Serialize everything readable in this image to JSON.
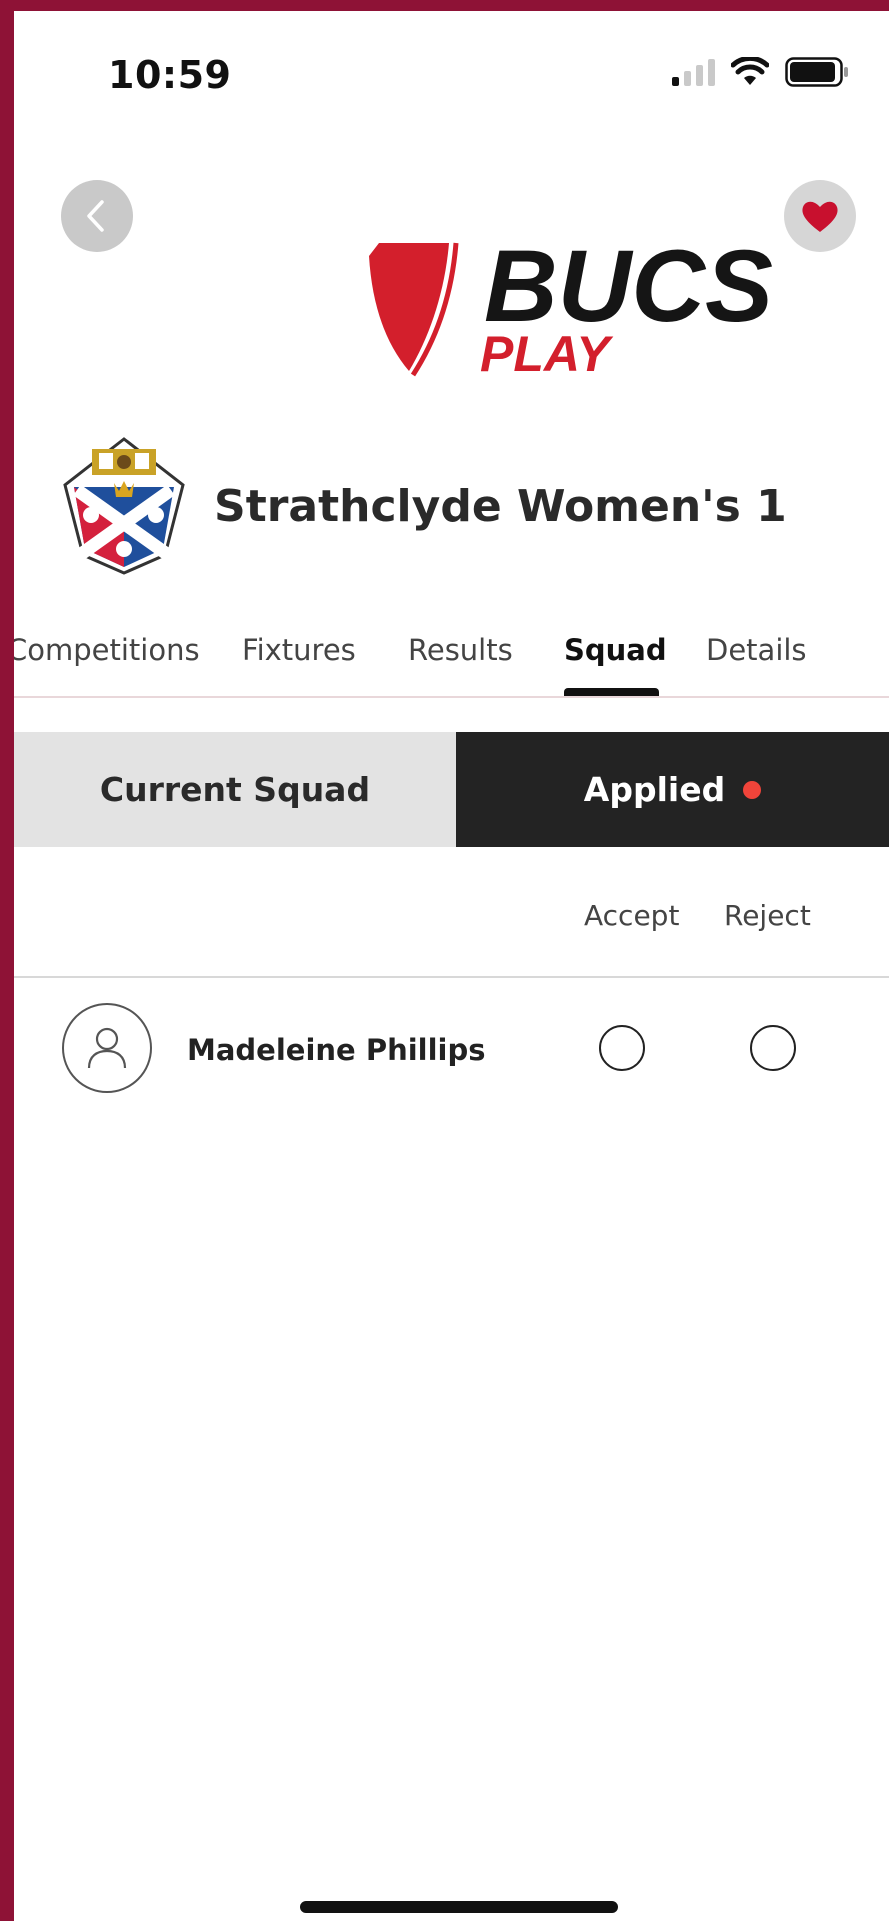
{
  "status_bar": {
    "time": "10:59"
  },
  "brand": {
    "logo_text": "BUCS",
    "logo_subtext": "PLAY",
    "accent": "#d31f2c"
  },
  "team": {
    "name": "Strathclyde Women's 1"
  },
  "tabs": [
    {
      "label": "Competitions",
      "active": false
    },
    {
      "label": "Fixtures",
      "active": false
    },
    {
      "label": "Results",
      "active": false
    },
    {
      "label": "Squad",
      "active": true
    },
    {
      "label": "Details",
      "active": false
    }
  ],
  "segment": {
    "current_label": "Current Squad",
    "applied_label": "Applied"
  },
  "list": {
    "columns": {
      "accept": "Accept",
      "reject": "Reject"
    },
    "rows": [
      {
        "name": "Madeleine Phillips",
        "accept": false,
        "reject": false
      }
    ]
  },
  "colors": {
    "frame": "#8e1236",
    "notification_dot": "#f0443a"
  },
  "icons": {
    "back": "chevron-left-icon",
    "favorite": "heart-icon",
    "avatar": "user-icon",
    "crest": "university-crest"
  }
}
